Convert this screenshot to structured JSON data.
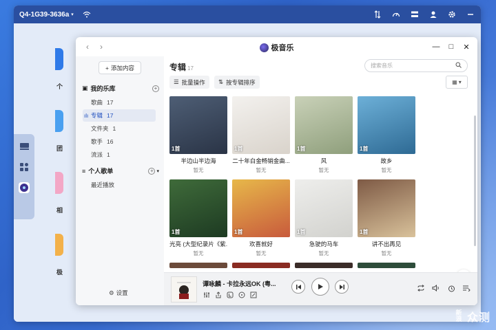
{
  "nas": {
    "device_name": "Q4-1G39-3636a",
    "topbar_icons": [
      "transfer-icon",
      "speedometer-icon",
      "layers-icon",
      "user-icon",
      "gear-icon",
      "minus-icon"
    ],
    "desktop_labels": [
      "个",
      "团",
      "相",
      "极"
    ]
  },
  "app": {
    "title": "极音乐",
    "add_content": "添加内容",
    "my_library": "我的乐库",
    "library_items": [
      {
        "label": "歌曲",
        "count": "17"
      },
      {
        "label": "专辑",
        "count": "17"
      },
      {
        "label": "文件夹",
        "count": "1"
      },
      {
        "label": "歌手",
        "count": "16"
      },
      {
        "label": "流派",
        "count": "1"
      }
    ],
    "personal_playlists": "个人歌单",
    "recent_play": "最近播放",
    "settings": "设置",
    "main_title": "专辑",
    "main_count": "17",
    "search_placeholder": "搜索音乐",
    "batch_action": "批量操作",
    "sort_by_album": "按专辑排序"
  },
  "albums": [
    {
      "title": "半边山半边海",
      "artist": "暂无",
      "count": "1首",
      "colors": [
        "#4e5e75",
        "#2a3446"
      ]
    },
    {
      "title": "二十年白金畅销金曲...",
      "artist": "暂无",
      "count": "1首",
      "colors": [
        "#f3f1ee",
        "#d9d3cb"
      ]
    },
    {
      "title": "风",
      "artist": "暂无",
      "count": "1首",
      "colors": [
        "#c9d1b8",
        "#8f9f7c"
      ]
    },
    {
      "title": "故乡",
      "artist": "暂无",
      "count": "1首",
      "colors": [
        "#6db0d8",
        "#2e6a94"
      ]
    },
    {
      "title": "光亮 (大型纪录片《紫...",
      "artist": "暂无",
      "count": "1首",
      "colors": [
        "#3f6b3a",
        "#1d3a22"
      ]
    },
    {
      "title": "欢喜就好",
      "artist": "暂无",
      "count": "1首",
      "colors": [
        "#e7b84a",
        "#c85a3c"
      ]
    },
    {
      "title": "急驶的马车",
      "artist": "暂无",
      "count": "1首",
      "colors": [
        "#eeeeec",
        "#d2d2ce"
      ]
    },
    {
      "title": "讲不出再见",
      "artist": "暂无",
      "count": "1首",
      "colors": [
        "#7e5a45",
        "#d9c29b"
      ]
    }
  ],
  "player": {
    "track": "谭咏麟 - 卡拉永远OK (粤..."
  },
  "watermark": {
    "logo": "新浪",
    "text": "众测"
  }
}
